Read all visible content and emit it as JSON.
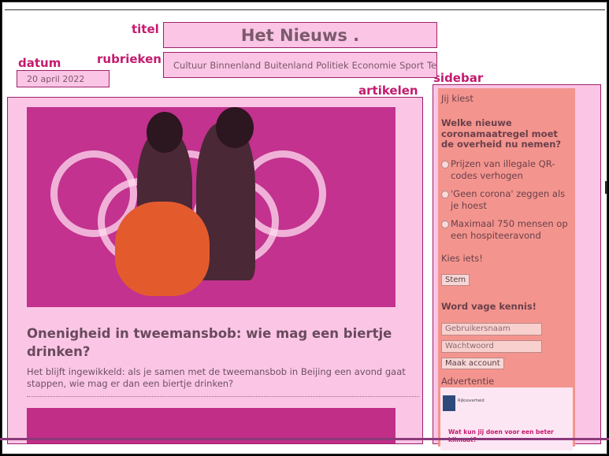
{
  "labels": {
    "titel": "titel",
    "rubrieken": "rubrieken",
    "datum": "datum",
    "artikelen": "artikelen",
    "sidebar": "sidebar"
  },
  "site_title": "Het Nieuws .",
  "sections": [
    "Cultuur",
    "Binnenland",
    "Buitenland",
    "Politiek",
    "Economie",
    "Sport",
    "Tech"
  ],
  "date": "20 april 2022",
  "article": {
    "headline": "Onenigheid in tweemansbob: wie mag een biertje drinken?",
    "summary": "Het blijft ingewikkeld: als je samen met de tweemansbob in Beijing een avond gaat stappen, wie mag er dan een biertje drinken?"
  },
  "sidebar": {
    "poll_intro": "Jij kiest",
    "question": "Welke nieuwe coronamaatregel moet de overheid nu nemen?",
    "options": [
      "Prijzen van illegale QR-codes verhogen",
      "'Geen corona' zeggen als je hoest",
      "Maximaal 750 mensen op een hospiteeravond"
    ],
    "choose": "Kies iets!",
    "vote_button": "Stem",
    "account_heading": "Word vage kennis!",
    "username_placeholder": "Gebruikersnaam",
    "password_placeholder": "Wachtwoord",
    "create_button": "Maak account",
    "ad_label": "Advertentie",
    "ad_org": "Rijksoverheid",
    "ad_text": "Wat kun jij doen voor een beter klimaat?"
  },
  "colors": {
    "label": "#c41a6e",
    "region_fill": "#fbc6e6",
    "sidebar_fill": "#f3958e"
  }
}
